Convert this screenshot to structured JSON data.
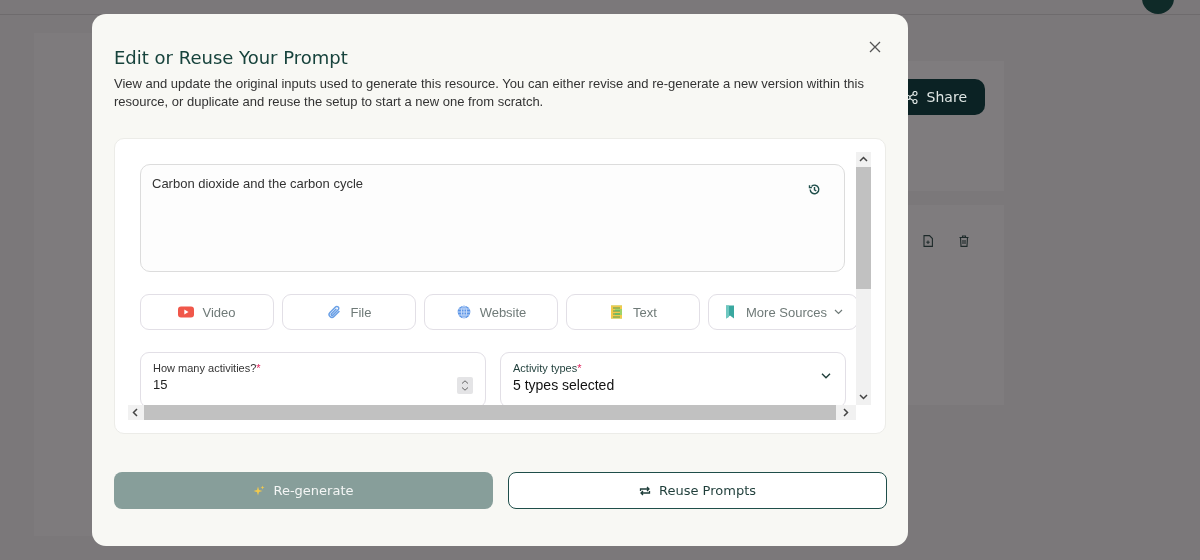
{
  "background": {
    "share_button": {
      "label": "Share"
    }
  },
  "dialog": {
    "title": "Edit or Reuse Your Prompt",
    "description": "View and update the original inputs used to generate this resource. You can either revise and re-generate a new version within this resource, or duplicate and reuse the setup to start a new one from scratch.",
    "prompt": {
      "value": "Carbon dioxide and the carbon cycle"
    },
    "sources": [
      {
        "label": "Video",
        "kind": "video"
      },
      {
        "label": "File",
        "kind": "file"
      },
      {
        "label": "Website",
        "kind": "website"
      },
      {
        "label": "Text",
        "kind": "text"
      },
      {
        "label": "More Sources",
        "kind": "more"
      }
    ],
    "fields": [
      {
        "kind": "number",
        "label": "How many activities?",
        "required_mark": "*",
        "value": "15"
      },
      {
        "kind": "select",
        "label": "Activity types",
        "required_mark": "*",
        "value": "5 types selected"
      }
    ],
    "buttons": [
      {
        "label": "Re-generate",
        "kind": "regenerate",
        "disabled": true
      },
      {
        "label": "Reuse Prompts",
        "kind": "reuse",
        "disabled": false
      }
    ]
  }
}
